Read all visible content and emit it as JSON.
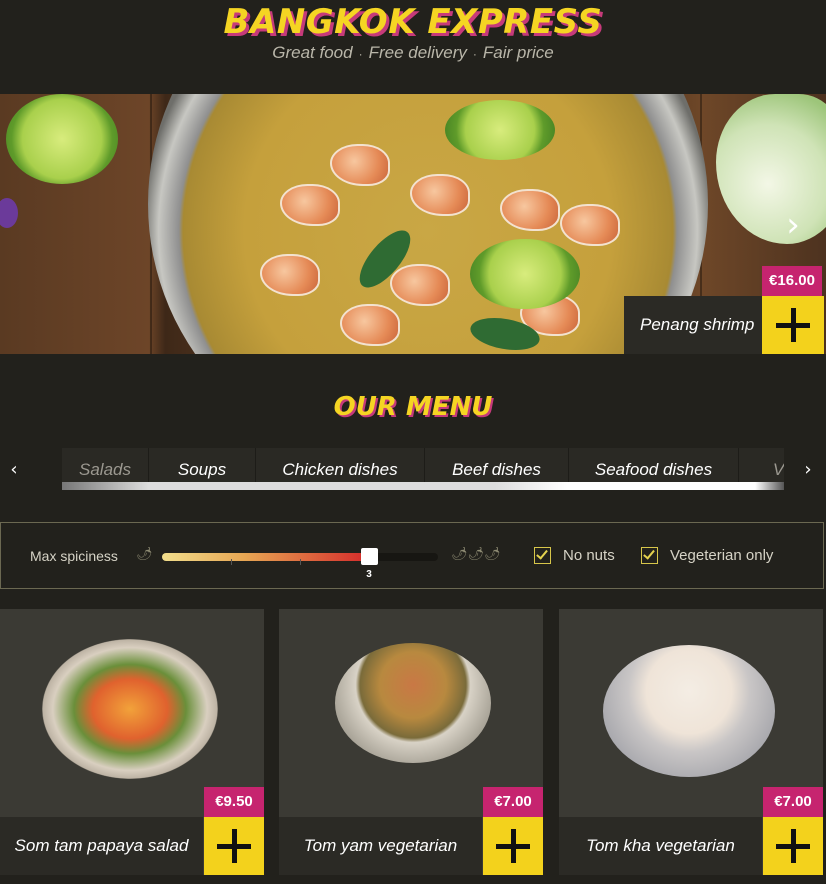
{
  "header": {
    "brand": "BANGKOK EXPRESS",
    "tagline": [
      "Great food",
      "Free delivery",
      "Fair price"
    ]
  },
  "hero": {
    "dish_name": "Penang shrimp",
    "price": "€16.00",
    "next_icon": "chevron-right-icon"
  },
  "menu": {
    "title": "OUR MENU",
    "categories": [
      "Salads",
      "Soups",
      "Chicken dishes",
      "Beef dishes",
      "Seafood dishes",
      "V"
    ],
    "prev_icon": "chevron-left-icon",
    "next_icon": "chevron-right-icon"
  },
  "filters": {
    "spiciness_label": "Max spiciness",
    "spiciness_value": "3",
    "spiciness_max": 4,
    "no_nuts_label": "No nuts",
    "no_nuts_checked": true,
    "vegetarian_label": "Vegeterian only",
    "vegetarian_checked": true
  },
  "products": [
    {
      "name": "Som tam papaya salad",
      "price": "€9.50"
    },
    {
      "name": "Tom yam vegetarian",
      "price": "€7.00"
    },
    {
      "name": "Tom kha vegetarian",
      "price": "€7.00"
    }
  ],
  "colors": {
    "background": "#22211c",
    "accent_yellow": "#f5d523",
    "accent_pink": "#c6246f",
    "add_button": "#f3d21c"
  }
}
